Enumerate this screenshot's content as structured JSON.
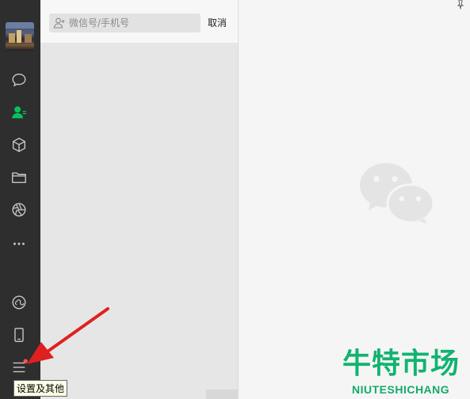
{
  "search": {
    "placeholder": "微信号/手机号",
    "cancel_label": "取消"
  },
  "nav": {
    "items": [
      {
        "icon": "chat-icon"
      },
      {
        "icon": "contacts-icon",
        "active": true
      },
      {
        "icon": "favorites-cube-icon"
      },
      {
        "icon": "folder-icon"
      },
      {
        "icon": "moments-aperture-icon"
      },
      {
        "icon": "more-dots-icon"
      },
      {
        "icon": "mini-program-icon"
      },
      {
        "icon": "phone-icon"
      },
      {
        "icon": "menu-icon",
        "badge": true
      }
    ],
    "tooltip": "设置及其他"
  },
  "colors": {
    "rail": "#2e2e2e",
    "active": "#07c160",
    "badge": "#fa5151",
    "arrow": "#e02020",
    "watermark": "#11b36f"
  },
  "watermark": {
    "chinese": "牛特市场",
    "english": "NIUTESHICHANG"
  }
}
